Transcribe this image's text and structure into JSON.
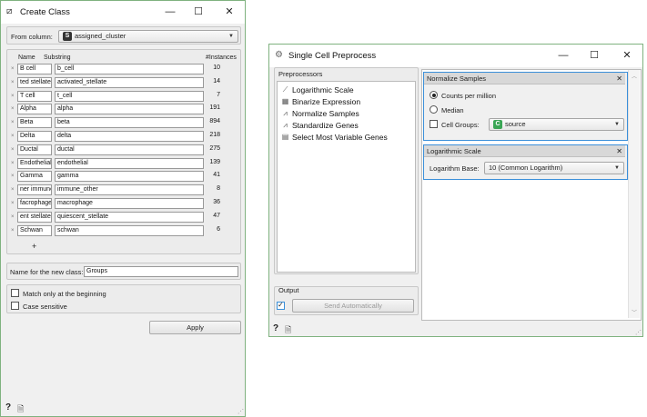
{
  "create_class": {
    "title": "Create Class",
    "from_column_label": "From column:",
    "from_column_value": "assigned_cluster",
    "from_column_badge": "S",
    "col_name": "Name",
    "col_substring": "Substring",
    "col_instances": "#Instances",
    "rows": [
      {
        "name": "B cell",
        "substring": "b_cell",
        "count": "10"
      },
      {
        "name": "ted stellate",
        "substring": "activated_stellate",
        "count": "14"
      },
      {
        "name": "T cell",
        "substring": "t_cell",
        "count": "7"
      },
      {
        "name": "Alpha",
        "substring": "alpha",
        "count": "191"
      },
      {
        "name": "Beta",
        "substring": "beta",
        "count": "894"
      },
      {
        "name": "Delta",
        "substring": "delta",
        "count": "218"
      },
      {
        "name": "Ductal",
        "substring": "ductal",
        "count": "275"
      },
      {
        "name": "Endothelial",
        "substring": "endothelial",
        "count": "139"
      },
      {
        "name": "Gamma",
        "substring": "gamma",
        "count": "41"
      },
      {
        "name": "ner immune",
        "substring": "immune_other",
        "count": "8"
      },
      {
        "name": "facrophage",
        "substring": "macrophage",
        "count": "36"
      },
      {
        "name": "ent stellate",
        "substring": "quiescent_stellate",
        "count": "47"
      },
      {
        "name": "Schwan",
        "substring": "schwan",
        "count": "6"
      }
    ],
    "remove_glyph": "×",
    "add_glyph": "+",
    "new_class_label": "Name for the new class:",
    "new_class_value": "Groups",
    "match_beginning_label": "Match only at the beginning",
    "case_sensitive_label": "Case sensitive",
    "apply_label": "Apply"
  },
  "single_cell": {
    "title": "Single Cell Preprocess",
    "preprocessors_label": "Preprocessors",
    "preprocessors": [
      {
        "icon": "log-scale-icon",
        "glyph": "⟋",
        "label": "Logarithmic Scale"
      },
      {
        "icon": "binarize-icon",
        "glyph": "▦",
        "label": "Binarize Expression"
      },
      {
        "icon": "normalize-icon",
        "glyph": "⩘",
        "label": "Normalize Samples"
      },
      {
        "icon": "standardize-icon",
        "glyph": "⩘",
        "label": "Standardize Genes"
      },
      {
        "icon": "variable-genes-icon",
        "glyph": "▤",
        "label": "Select Most Variable Genes"
      }
    ],
    "output_label": "Output",
    "send_auto_label": "Send Automatically",
    "normalize": {
      "header": "Normalize Samples",
      "cpm_label": "Counts per million",
      "median_label": "Median",
      "cell_groups_label": "Cell Groups:",
      "cell_groups_value": "source",
      "cell_groups_badge": "C"
    },
    "logscale": {
      "header": "Logarithmic Scale",
      "base_label": "Logarithm Base:",
      "base_value": "10 (Common Logarithm)"
    }
  },
  "window_buttons": {
    "minimize": "—",
    "maximize": "☐",
    "close": "✕"
  },
  "footer": {
    "help": "?",
    "report": "🗎"
  },
  "colors": {
    "accent_border": "#3b8fd9",
    "badge_s": "#333333",
    "badge_c": "#3aa655"
  }
}
